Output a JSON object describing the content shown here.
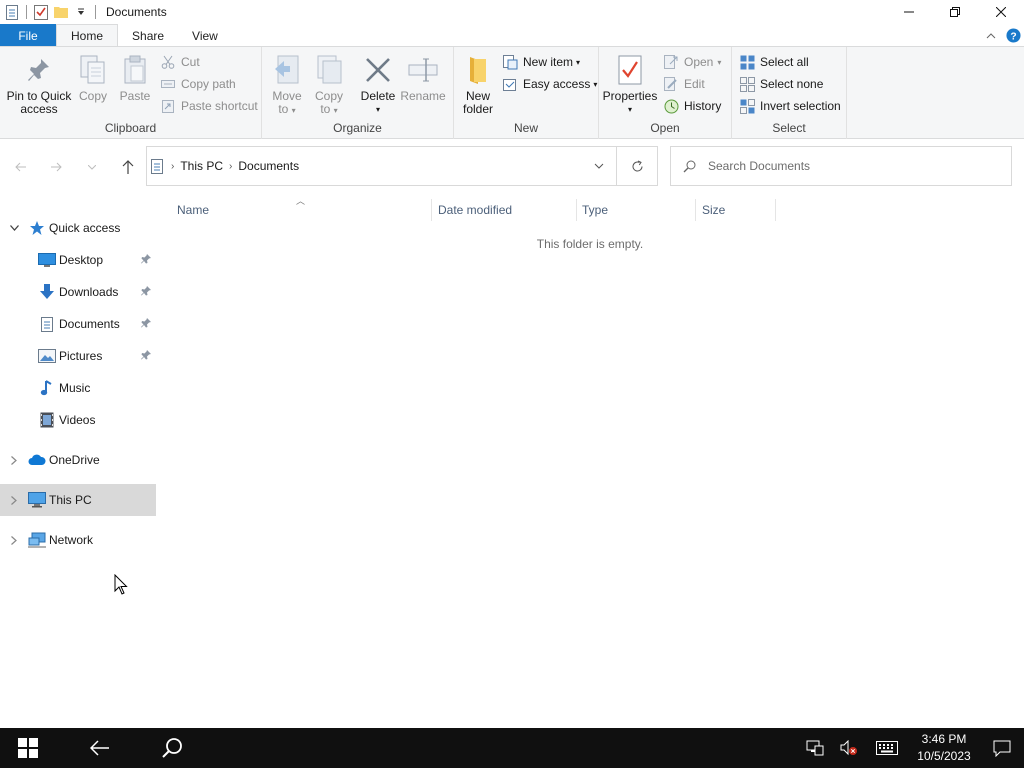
{
  "window": {
    "title": "Documents",
    "accent": "#1979ca"
  },
  "ribbon_tabs": [
    {
      "label": "File"
    },
    {
      "label": "Home"
    },
    {
      "label": "Share"
    },
    {
      "label": "View"
    }
  ],
  "ribbon": {
    "clipboard": {
      "label": "Clipboard",
      "pin_line1": "Pin to Quick",
      "pin_line2": "access",
      "copy": "Copy",
      "paste": "Paste",
      "cut": "Cut",
      "copy_path": "Copy path",
      "paste_shortcut": "Paste shortcut"
    },
    "organize": {
      "label": "Organize",
      "move_line1": "Move",
      "move_line2": "to",
      "copy_line1": "Copy",
      "copy_line2": "to",
      "delete": "Delete",
      "rename": "Rename"
    },
    "new": {
      "label": "New",
      "new_folder_line1": "New",
      "new_folder_line2": "folder",
      "new_item": "New item",
      "easy_access": "Easy access"
    },
    "open": {
      "label": "Open",
      "properties": "Properties",
      "open": "Open",
      "edit": "Edit",
      "history": "History"
    },
    "select": {
      "label": "Select",
      "select_all": "Select all",
      "select_none": "Select none",
      "invert_selection": "Invert selection"
    }
  },
  "address": {
    "crumbs": [
      "This PC",
      "Documents"
    ],
    "search_placeholder": "Search Documents"
  },
  "nav": {
    "quick_access": "Quick access",
    "items": [
      {
        "label": "Desktop",
        "icon": "desktop-icon",
        "pinned": true
      },
      {
        "label": "Downloads",
        "icon": "downloads-icon",
        "pinned": true
      },
      {
        "label": "Documents",
        "icon": "documents-icon",
        "pinned": true
      },
      {
        "label": "Pictures",
        "icon": "pictures-icon",
        "pinned": true
      },
      {
        "label": "Music",
        "icon": "music-icon",
        "pinned": false
      },
      {
        "label": "Videos",
        "icon": "videos-icon",
        "pinned": false
      }
    ],
    "onedrive": "OneDrive",
    "this_pc": "This PC",
    "network": "Network"
  },
  "content": {
    "columns": [
      "Name",
      "Date modified",
      "Type",
      "Size"
    ],
    "empty_message": "This folder is empty."
  },
  "taskbar": {
    "time": "3:46 PM",
    "date": "10/5/2023"
  }
}
